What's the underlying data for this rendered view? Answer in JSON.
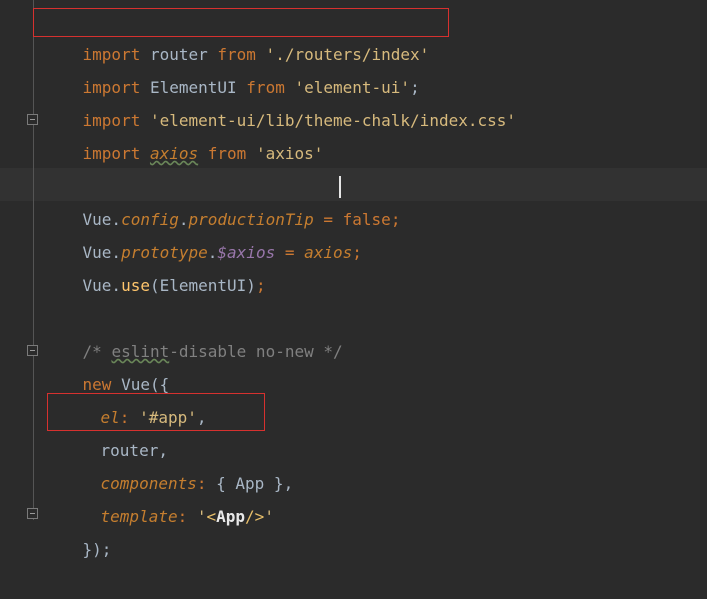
{
  "code": {
    "line1": {
      "kw1": "import",
      "id": " router ",
      "kw2": "from",
      "str": " './routers/index'"
    },
    "line2": {
      "kw1": "import",
      "id": " ElementUI ",
      "kw2": "from",
      "str": " 'element-ui'",
      "end": ";"
    },
    "line3": {
      "kw1": "import",
      "str": " 'element-ui/lib/theme-chalk/index.css'"
    },
    "line4": {
      "kw1": "import",
      "id": "axios",
      "kw2": "from",
      "str": " 'axios'"
    },
    "line6": {
      "obj": "Vue.",
      "p1": "config",
      "dot": ".",
      "p2": "productionTip",
      "eq": " = ",
      "val": "false",
      "end": ";"
    },
    "line7": {
      "obj": "Vue.",
      "p1": "prototype",
      "dot": ".",
      "p2": "$axios",
      "eq": " = ",
      "val": "axios",
      "end": ";"
    },
    "line8": {
      "obj": "Vue.",
      "fn": "use",
      "args": "(ElementUI)",
      "end": ";"
    },
    "line10": {
      "comment_start": "/* ",
      "comment_word": "eslint",
      "comment_rest": "-disable no-new */"
    },
    "line11": {
      "kw": "new",
      "rest": " Vue({"
    },
    "line12": {
      "key": "el",
      "colon": ": ",
      "val": "'#app'",
      "end": ","
    },
    "line13": {
      "text": "router,"
    },
    "line14": {
      "key": "components",
      "colon": ": ",
      "val": "{ App }",
      "end": ","
    },
    "line15": {
      "key": "template",
      "colon": ": ",
      "q1": "'",
      "lt": "<",
      "tag": "App",
      "gt": "/>",
      "q2": "'"
    },
    "line16": {
      "text": "});"
    }
  },
  "colors": {
    "background": "#2b2b2b",
    "keyword": "#cc7832",
    "string": "#a5c25c",
    "highlight_box": "#d6312f"
  }
}
